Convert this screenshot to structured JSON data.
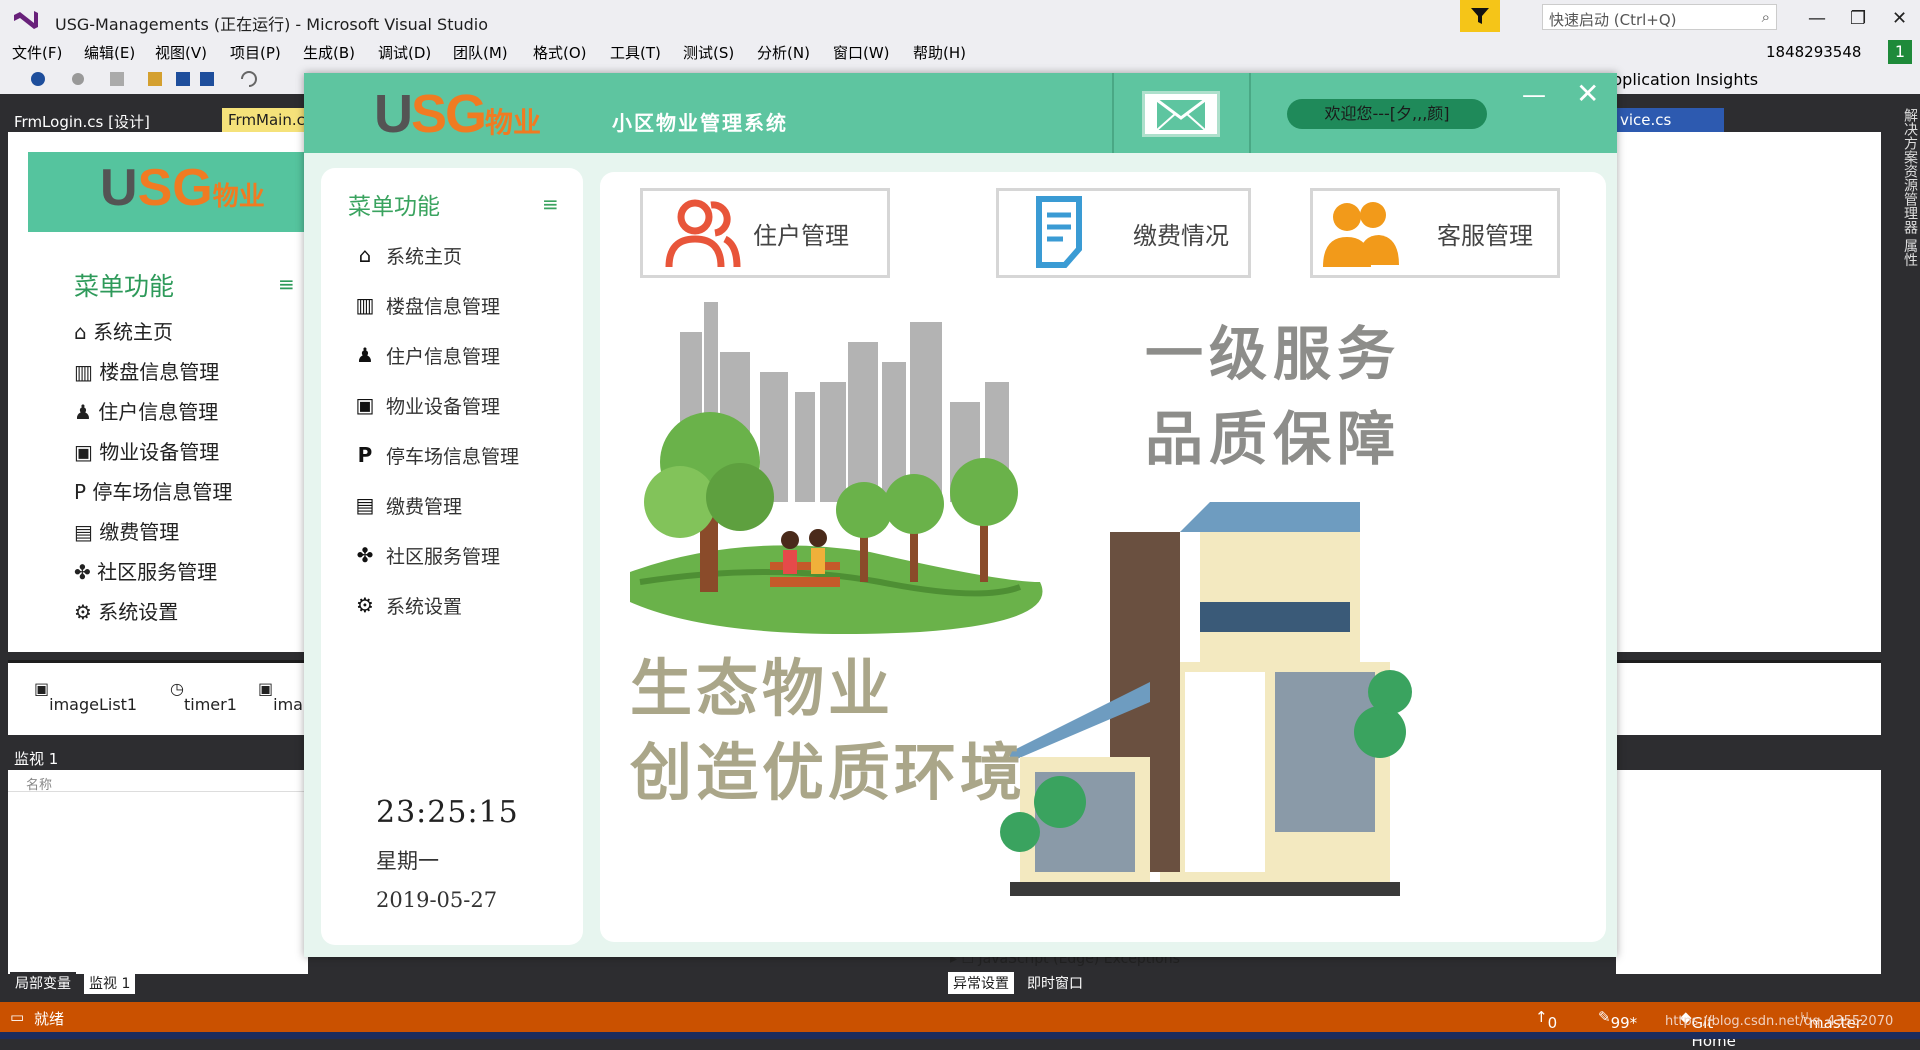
{
  "vs": {
    "title": "USG-Managements (正在运行) - Microsoft Visual Studio",
    "quick_launch": "快速启动 (Ctrl+Q)",
    "account": "1848293548",
    "account_badge": "1",
    "menu": [
      "文件(F)",
      "编辑(E)",
      "视图(V)",
      "项目(P)",
      "生成(B)",
      "调试(D)",
      "团队(M)",
      "格式(O)",
      "工具(T)",
      "测试(S)",
      "分析(N)",
      "窗口(W)",
      "帮助(H)"
    ],
    "app_insights": "pplication Insights",
    "tabs": {
      "login": "FrmLogin.cs [设计]",
      "main": "FrmMain.c",
      "service": "vice.cs"
    },
    "tray": [
      "imageList1",
      "timer1",
      "ima"
    ],
    "watch_title": "监视 1",
    "watch_col": "名称",
    "bottom_left_tabs": [
      "局部变量",
      "监视 1"
    ],
    "bottom_right_tabs": [
      "异常设置",
      "即时窗口"
    ],
    "exception_row": "JavaScript (Edge) Exceptions",
    "status": {
      "ready": "就绪",
      "up": "0",
      "edits": "99*",
      "git": "Git Home",
      "branch": "master",
      "watermark": "https://blog.csdn.net/qq_43552070"
    },
    "side_strip": "解决方案资源管理器  属性"
  },
  "designer": {
    "menu_title": "菜单功能",
    "items": [
      "系统主页",
      "楼盘信息管理",
      "住户信息管理",
      "物业设备管理",
      "停车场信息管理",
      "缴费管理",
      "社区服务管理",
      "系统设置"
    ]
  },
  "app": {
    "logo": {
      "u": "U",
      "sg": "SG",
      "wy": "物业"
    },
    "system_title": "小区物业管理系统",
    "welcome": "欢迎您---[夕,,,颜]",
    "menu_title": "菜单功能",
    "menu_items": [
      {
        "label": "系统主页",
        "icon": "home-icon"
      },
      {
        "label": "楼盘信息管理",
        "icon": "building-icon"
      },
      {
        "label": "住户信息管理",
        "icon": "resident-icon"
      },
      {
        "label": "物业设备管理",
        "icon": "device-icon"
      },
      {
        "label": "停车场信息管理",
        "icon": "parking-icon"
      },
      {
        "label": "缴费管理",
        "icon": "payment-icon"
      },
      {
        "label": "社区服务管理",
        "icon": "community-icon"
      },
      {
        "label": "系统设置",
        "icon": "settings-icon"
      }
    ],
    "clock": {
      "time": "23:25:15",
      "weekday": "星期一",
      "date": "2019-05-27"
    },
    "cards": [
      {
        "label": "住户管理",
        "icon": "residents-icon",
        "color": "#e8553a"
      },
      {
        "label": "缴费情况",
        "icon": "bill-icon",
        "color": "#3a9bd4"
      },
      {
        "label": "客服管理",
        "icon": "service-icon",
        "color": "#f29a1a"
      }
    ],
    "slogans": {
      "top1": "一级服务",
      "top2": "品质保障",
      "bottom1": "生态物业",
      "bottom2": "创造优质环境"
    },
    "colors": {
      "header": "#5ec5a0",
      "accent_green": "#3aa35f",
      "logo_orange": "#f07b22"
    }
  }
}
